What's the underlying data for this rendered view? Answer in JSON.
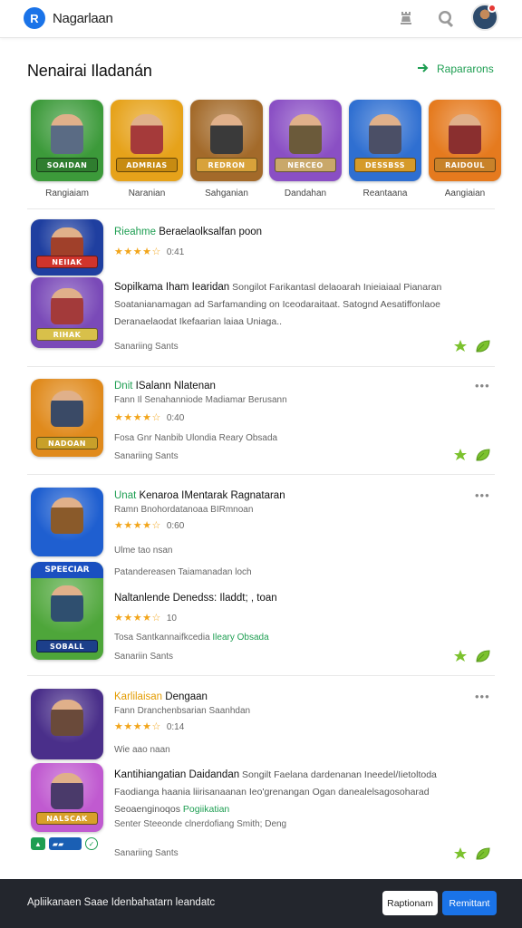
{
  "header": {
    "app_name": "Nagarlaan",
    "logo_letter": "R",
    "icons": [
      "rook-icon",
      "search-icon"
    ],
    "avatar_notification": true
  },
  "section": {
    "title": "Nenairai Iladanán",
    "see_all_label": "Rapararons"
  },
  "featured": [
    {
      "label": "Rangiaiam",
      "banner": "SOAIDAN",
      "bg": "#3c9a3a",
      "fig": "#5a6b84",
      "band": "#2f7d2f"
    },
    {
      "label": "Naranian",
      "banner": "ADMRIAS",
      "bg": "#e6a21a",
      "fig": "#a53a3a",
      "band": "#c78b12"
    },
    {
      "label": "Sahganian",
      "banner": "REDRON",
      "bg": "#a36a2a",
      "fig": "#3a3a3a",
      "band": "#d8a23a"
    },
    {
      "label": "Dandahan",
      "banner": "NERCEO",
      "bg": "#8a4fc4",
      "fig": "#6b5a3a",
      "band": "#c9a86a"
    },
    {
      "label": "Reantaana",
      "banner": "DESSBSS",
      "bg": "#2f6fd1",
      "fig": "#4b4f66",
      "band": "#d59a2a"
    },
    {
      "label": "Aangiaian",
      "banner": "RAIDOUL",
      "bg": "#e57a1e",
      "fig": "#8a2f2f",
      "band": "#c8822a"
    }
  ],
  "cards": [
    {
      "title_accent": "Rieahme",
      "title_rest": " Beraelaolksalfan poon",
      "rating": "0:41",
      "desc_title": "Sopilkama Iham Iearidan",
      "desc_body": " Songilot Farikantasl delaoarah Inieiaiaal Pianaran Soatanianamagan ad Sarfamanding on Iceodaraitaat. Satognd Aesatiffonlaoe Deranaelaodat Ikefaarian laiaa Uniaga..",
      "footer": "Sanariing Sants",
      "thumbs": [
        {
          "banner": "NEIIAK",
          "bg": "#1f3fa0",
          "fig": "#a0402a",
          "band": "#d0342c"
        },
        {
          "banner": "RIHAK",
          "bg": "#7a4ab8",
          "fig": "#a33a3a",
          "band": "#d8c04a"
        }
      ]
    },
    {
      "title_accent": "Dnit",
      "title_rest": " ISalann Nlatenan",
      "sub": "Fann Il Senahanniode Madiamar Berusann",
      "rating": "0:40",
      "tagline": "Fosa Gnr Nanbib Ulondia Reary Obsada",
      "footer": "Sanariing Sants",
      "thumbs": [
        {
          "banner": "NADOAN",
          "bg": "#e08a1c",
          "fig": "#3a4a66",
          "band": "#c8a02a"
        }
      ]
    },
    {
      "title_accent": "Unat",
      "title_rest": " Kenaroa IMentarak Ragnataran",
      "sub": "Ramn Bnohordatanoaa BIRmnoan",
      "rating": "0:60",
      "line2": "Ulme tao nsan",
      "line3": "Patandereasen Taiamanadan loch",
      "sub_title": "Naltanlende Denedss: Iladdt; , toan",
      "sub_rating": "10",
      "tagline_gray": "Tosa Santkannaifkcedia",
      "tagline_accent": "Ileary Obsada",
      "footer": "Sanariin Sants",
      "thumbs": [
        {
          "banner": "",
          "bg": "#1f5fd0",
          "fig": "#8a5a2a",
          "band": "#e07a1a"
        },
        {
          "banner": "SOBALL",
          "bg": "#4ea63a",
          "fig": "#2f4f6f",
          "band": "#1c3f8a",
          "top_banner": "SPEECIAR"
        }
      ]
    },
    {
      "title_accent": "Karlilaisan",
      "title_rest": " Dengaan",
      "sub": "Fann Dranchenbsarian Saanhdan",
      "rating": "0:14",
      "line2": "Wie aao naan",
      "desc_title": "Kantihiangatian Daidandan",
      "desc_body": " Songilt Faelana dardenanan Ineedel/Iietoltoda Faodianga haania liirisanaanan Ieo'grenangan Ogan danealelsagosoharad Seoaenginoqos",
      "desc_link": "Pogiikatian",
      "desc_tail": "Senter Steeonde clnerdofiang Smith; Deng",
      "footer": "Sanariing Sants",
      "thumbs": [
        {
          "banner": "",
          "bg": "#4a2f8a",
          "fig": "#6a4a3a",
          "band": "#d0842a"
        },
        {
          "banner": "NALSCAK",
          "bg": "#c05ad0",
          "fig": "#4a3a6a",
          "band": "#d8a02a"
        }
      ]
    }
  ],
  "bottom_bar": {
    "text": "Apliikanaen Saae Idenbahatarn leandatc",
    "secondary_label": "Raptionam",
    "primary_label": "Remittant"
  },
  "colors": {
    "accent_green": "#1e9e52",
    "primary_blue": "#1a73e8",
    "star_gold": "#f2a51a",
    "bottom_bar_bg": "#23262d"
  }
}
